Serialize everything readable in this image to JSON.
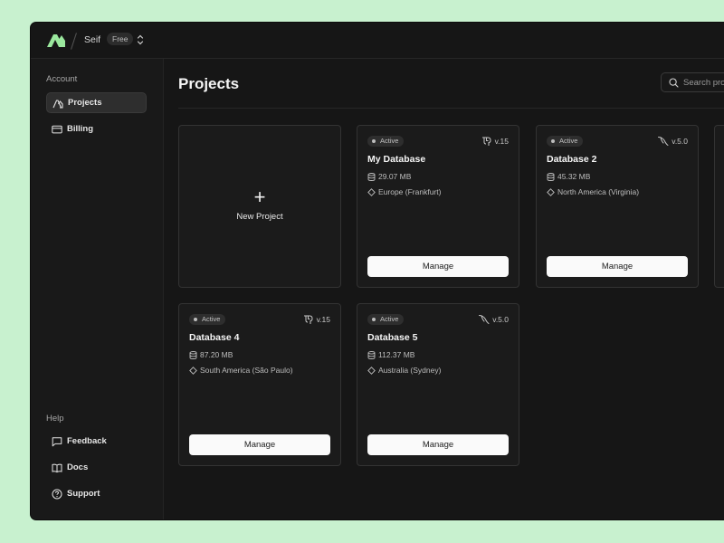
{
  "header": {
    "workspace": "Seif",
    "plan": "Free"
  },
  "sidebar": {
    "account_label": "Account",
    "account_items": [
      {
        "label": "Projects",
        "icon": "projects-icon",
        "active": true
      },
      {
        "label": "Billing",
        "icon": "credit-card-icon",
        "active": false
      }
    ],
    "help_label": "Help",
    "help_items": [
      {
        "label": "Feedback",
        "icon": "chat-bubble-icon"
      },
      {
        "label": "Docs",
        "icon": "book-icon"
      },
      {
        "label": "Support",
        "icon": "help-circle-icon"
      }
    ]
  },
  "main": {
    "title": "Projects",
    "search_placeholder": "Search projects",
    "new_project_label": "New Project",
    "manage_label": "Manage",
    "projects": [
      {
        "status": "Active",
        "engine": "postgres",
        "version": "v.15",
        "name": "My Database",
        "size": "29.07 MB",
        "region": "Europe (Frankfurt)"
      },
      {
        "status": "Active",
        "engine": "mysql",
        "version": "v.5.0",
        "name": "Database 2",
        "size": "45.32 MB",
        "region": "North America (Virginia)"
      },
      {
        "status": "Active",
        "engine": "postgres",
        "version": "v.15",
        "name": "Database 4",
        "size": "87.20 MB",
        "region": "South America (São Paulo)"
      },
      {
        "status": "Active",
        "engine": "mysql",
        "version": "v.5.0",
        "name": "Database 5",
        "size": "112.37 MB",
        "region": "Australia (Sydney)"
      }
    ]
  },
  "colors": {
    "brand": "#9be89e",
    "background": "#c8f1cf",
    "surface": "#161616"
  }
}
